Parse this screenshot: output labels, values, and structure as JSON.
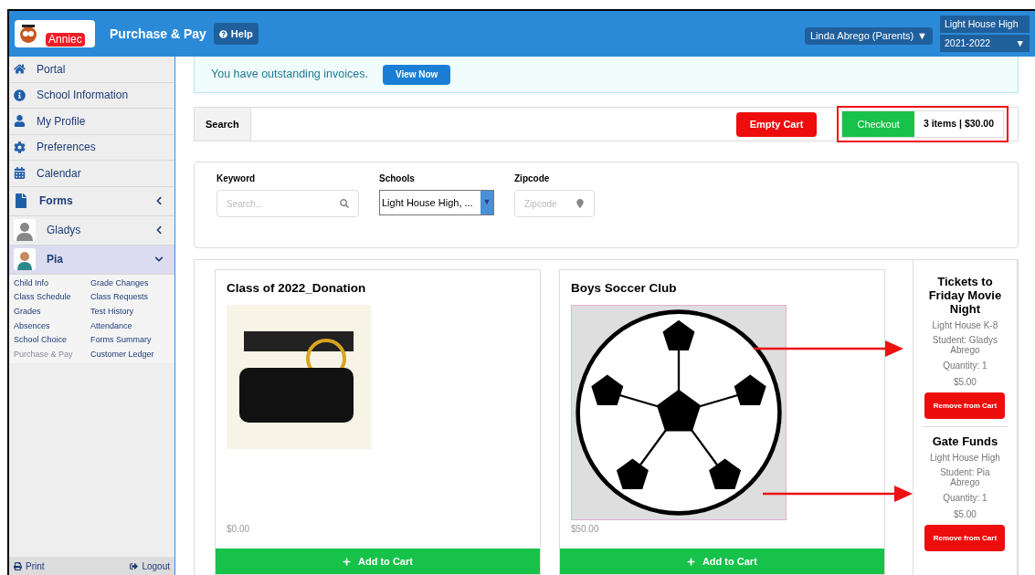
{
  "header": {
    "badge": "Anniec",
    "title": "Purchase & Pay",
    "help": "Help",
    "user_menu": "Linda Abrego (Parents)",
    "caret": "▼",
    "school": "Light House High",
    "year": "2021-2022"
  },
  "sidebar": {
    "items": [
      {
        "label": "Portal",
        "kind": "link"
      },
      {
        "label": "School Information",
        "kind": "link"
      },
      {
        "label": "My Profile",
        "kind": "link"
      },
      {
        "label": "Preferences",
        "kind": "link"
      },
      {
        "label": "Calendar",
        "kind": "link"
      },
      {
        "label": "Forms",
        "kind": "group",
        "expanded": false
      },
      {
        "label": "Gladys",
        "kind": "student",
        "expanded": false,
        "selected": false
      },
      {
        "label": "Pia",
        "kind": "student",
        "expanded": true,
        "selected": true,
        "links": [
          {
            "label": "Child Info",
            "disabled": false
          },
          {
            "label": "Grade Changes",
            "disabled": false
          },
          {
            "label": "Class Schedule",
            "disabled": false
          },
          {
            "label": "Class Requests",
            "disabled": false
          },
          {
            "label": "Grades",
            "disabled": false
          },
          {
            "label": "Test History",
            "disabled": false
          },
          {
            "label": "Absences",
            "disabled": false
          },
          {
            "label": "Attendance",
            "disabled": false
          },
          {
            "label": "School Choice",
            "disabled": false
          },
          {
            "label": "Forms Summary",
            "disabled": false
          },
          {
            "label": "Purchase & Pay",
            "disabled": true
          },
          {
            "label": "Customer Ledger",
            "disabled": false
          }
        ]
      }
    ],
    "footer": {
      "print": "Print",
      "logout": "Logout"
    }
  },
  "banner": {
    "text": "You have outstanding invoices.",
    "button": "View Now"
  },
  "tabs": [
    {
      "label": "Search",
      "selected": true
    }
  ],
  "cart_actions": {
    "empty": "Empty Cart",
    "checkout": "Checkout",
    "summary": "3 items | $30.00"
  },
  "filters": [
    {
      "label": "Keyword",
      "kind": "search",
      "placeholder": "Search..."
    },
    {
      "label": "Schools",
      "kind": "select",
      "value": "Light House High, ..."
    },
    {
      "label": "Zipcode",
      "kind": "location",
      "placeholder": "Zipcode"
    }
  ],
  "products": [
    {
      "title": "Class of 2022_Donation",
      "price": "$0.00",
      "button": "Add to Cart",
      "kind": "graphic"
    },
    {
      "title": "Boys Soccer Club",
      "price": "$50.00",
      "button": "Add to Cart",
      "kind": "ball"
    }
  ],
  "cart": [
    {
      "title": "Tickets to Friday Movie Night",
      "school": "Light House K-8",
      "student": "Student: Gladys Abrego",
      "quantity": "Quantity: 1",
      "price": "$5.00",
      "button": "Remove from Cart"
    },
    {
      "title": "Gate Funds",
      "school": "Light House High",
      "student": "Student: Pia Abrego",
      "quantity": "Quantity: 1",
      "price": "$5.00",
      "button": "Remove from Cart"
    }
  ]
}
